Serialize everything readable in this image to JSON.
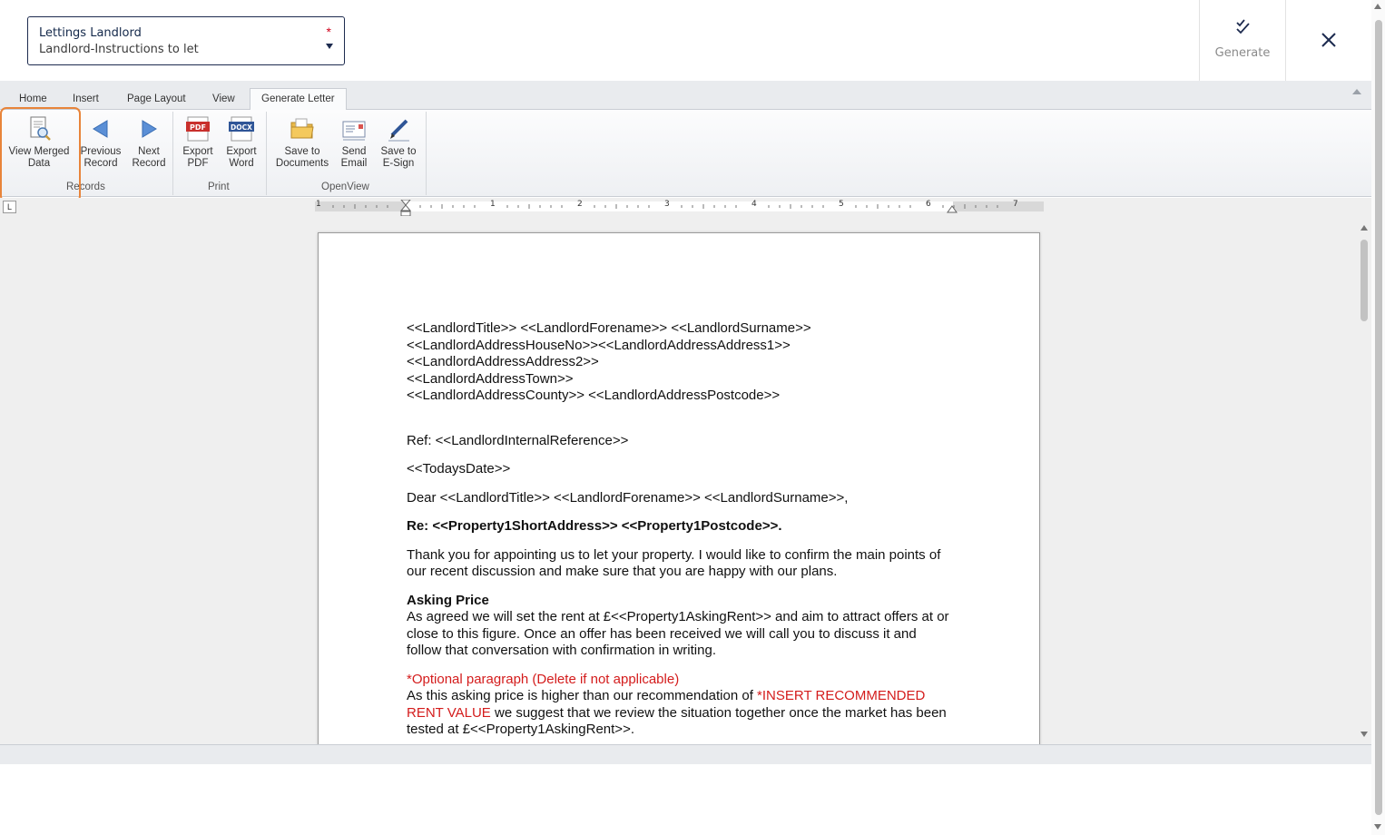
{
  "template_selector": {
    "label": "Lettings Landlord",
    "value": "Landlord-Instructions to let",
    "required_marker": "*"
  },
  "header_actions": {
    "generate_label": "Generate",
    "generate_icon": "double-check-icon",
    "close_icon": "close-icon"
  },
  "ribbon": {
    "tabs": [
      "Home",
      "Insert",
      "Page Layout",
      "View",
      "Generate Letter"
    ],
    "active_tab": "Generate Letter",
    "groups": {
      "records": "Records",
      "print": "Print",
      "openview": "OpenView"
    },
    "buttons": {
      "view_merged_line1": "View Merged",
      "view_merged_line2": "Data",
      "previous_line1": "Previous",
      "previous_line2": "Record",
      "next_line1": "Next",
      "next_line2": "Record",
      "export_pdf_line1": "Export",
      "export_pdf_line2": "PDF",
      "export_word_line1": "Export",
      "export_word_line2": "Word",
      "save_docs_line1": "Save to",
      "save_docs_line2": "Documents",
      "send_email_line1": "Send",
      "send_email_line2": "Email",
      "save_esign_line1": "Save to",
      "save_esign_line2": "E-Sign"
    },
    "icon_text": {
      "pdf": "PDF",
      "docx": "DOCX"
    }
  },
  "ruler": {
    "corner": "L",
    "numbers": [
      "1",
      "1",
      "2",
      "3",
      "4",
      "5",
      "6",
      "7"
    ]
  },
  "document": {
    "address_lines": [
      "<<LandlordTitle>> <<LandlordForename>> <<LandlordSurname>>",
      "<<LandlordAddressHouseNo>><<LandlordAddressAddress1>>",
      "<<LandlordAddressAddress2>>",
      "<<LandlordAddressTown>>",
      "<<LandlordAddressCounty>> <<LandlordAddressPostcode>>"
    ],
    "ref": "Ref: <<LandlordInternalReference>>",
    "date": "<<TodaysDate>>",
    "salutation": "Dear <<LandlordTitle>> <<LandlordForename>> <<LandlordSurname>>,",
    "re_line": "Re: <<Property1ShortAddress>> <<Property1Postcode>>.",
    "intro": "Thank you for appointing us to let your property. I would like to confirm the main points of our recent discussion and make sure that you are happy with our plans.",
    "asking_price_heading": "Asking Price",
    "asking_price_text": "As agreed we will set the rent at £<<Property1AskingRent>> and aim to attract offers at or close to this figure.  Once an offer has been received we will call you to discuss it and follow that conversation with confirmation in writing.",
    "optional_heading": "*Optional paragraph (Delete if not applicable)",
    "optional_text_before": "As this asking price is higher than our recommendation of ",
    "optional_insert": "*INSERT RECOMMENDED RENT VALUE",
    "optional_text_after": " we suggest that we review the situation together once the market has been tested at £<<Property1AskingRent>>."
  },
  "colors": {
    "highlight": "#e8843a",
    "required": "#d0021b",
    "optional_text": "#d41c1c",
    "selector_border": "#1d2b4f"
  }
}
